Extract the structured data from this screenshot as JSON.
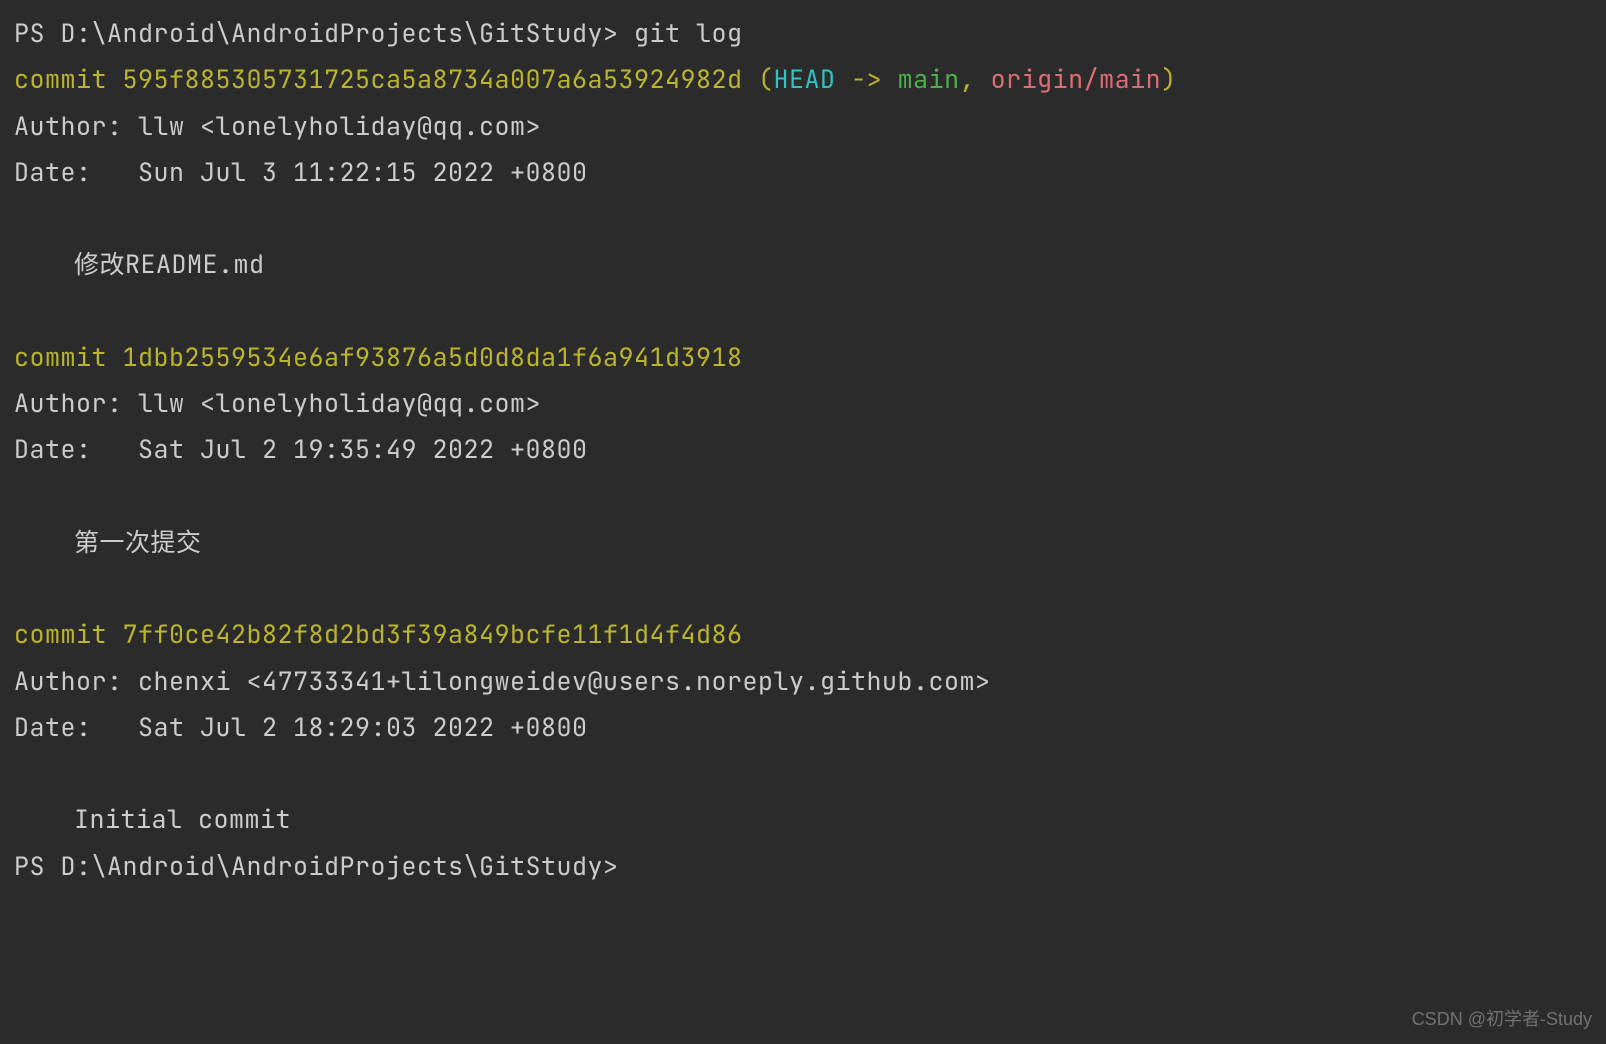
{
  "prompt1_path": "PS D:\\Android\\AndroidProjects\\GitStudy> ",
  "command": "git log",
  "commits": [
    {
      "prefix": "commit ",
      "hash": "595f885305731725ca5a8734a007a6a53924982d",
      "refs_open": " (",
      "head": "HEAD",
      "arrow": " -> ",
      "branch_local": "main",
      "comma": ", ",
      "branch_remote": "origin/main",
      "refs_close": ")",
      "author": "Author: llw <lonelyholiday@qq.com>",
      "date": "Date:   Sun Jul 3 11:22:15 2022 +0800",
      "message": "修改README.md"
    },
    {
      "prefix": "commit ",
      "hash": "1dbb2559534e6af93876a5d0d8da1f6a941d3918",
      "author": "Author: llw <lonelyholiday@qq.com>",
      "date": "Date:   Sat Jul 2 19:35:49 2022 +0800",
      "message": "第一次提交"
    },
    {
      "prefix": "commit ",
      "hash": "7ff0ce42b82f8d2bd3f39a849bcfe11f1d4f4d86",
      "author": "Author: chenxi <47733341+lilongweidev@users.noreply.github.com>",
      "date": "Date:   Sat Jul 2 18:29:03 2022 +0800",
      "message": "Initial commit"
    }
  ],
  "prompt2_path": "PS D:\\Android\\AndroidProjects\\GitStudy>",
  "watermark": "CSDN @初学者-Study"
}
